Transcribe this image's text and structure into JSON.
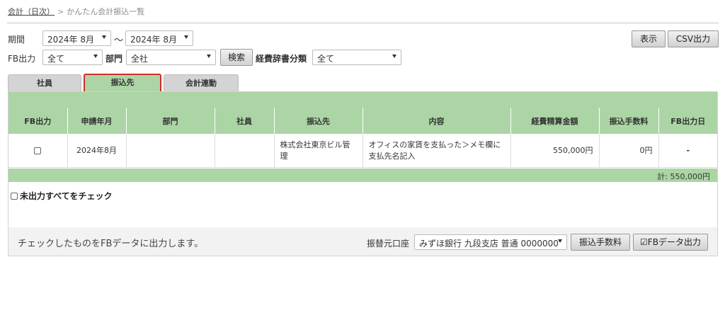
{
  "breadcrumb": {
    "parent": "会計（日次）",
    "separator": ">",
    "current": "かんたん会計振込一覧"
  },
  "filters": {
    "period_label": "期間",
    "period_from": "2024年 8月",
    "period_tilde": "〜",
    "period_to": "2024年 8月",
    "fb_label": "FB出力",
    "fb_value": "全て",
    "dept_label": "部門",
    "dept_value": "全社",
    "search_label": "検索",
    "category_label": "経費辞書分類",
    "category_value": "全て"
  },
  "actions": {
    "display_label": "表示",
    "csv_label": "CSV出力"
  },
  "tabs": [
    {
      "label": "社員",
      "active": false
    },
    {
      "label": "振込先",
      "active": true
    },
    {
      "label": "会計連動",
      "active": false
    }
  ],
  "table": {
    "headers": [
      "FB出力",
      "申請年月",
      "部門",
      "社員",
      "振込先",
      "内容",
      "経費精算金額",
      "振込手数料",
      "FB出力日"
    ],
    "rows": [
      {
        "fb_checked": false,
        "month": "2024年8月",
        "dept": "",
        "employee": "",
        "payee": "株式会社東京ビル管理",
        "content": "オフィスの家賃を支払った＞メモ欄に支払先名記入",
        "amount": "550,000円",
        "fee": "0円",
        "fb_date": "-"
      }
    ],
    "total": "計: 550,000円"
  },
  "check_all_label": "未出力すべてをチェック",
  "footer": {
    "message": "チェックしたものをFBデータに出力します。",
    "account_label": "振替元口座",
    "account_value": "みずほ銀行 九段支店 普通 0000000",
    "fee_button": "振込手数料",
    "fb_button": "☑FBデータ出力"
  }
}
